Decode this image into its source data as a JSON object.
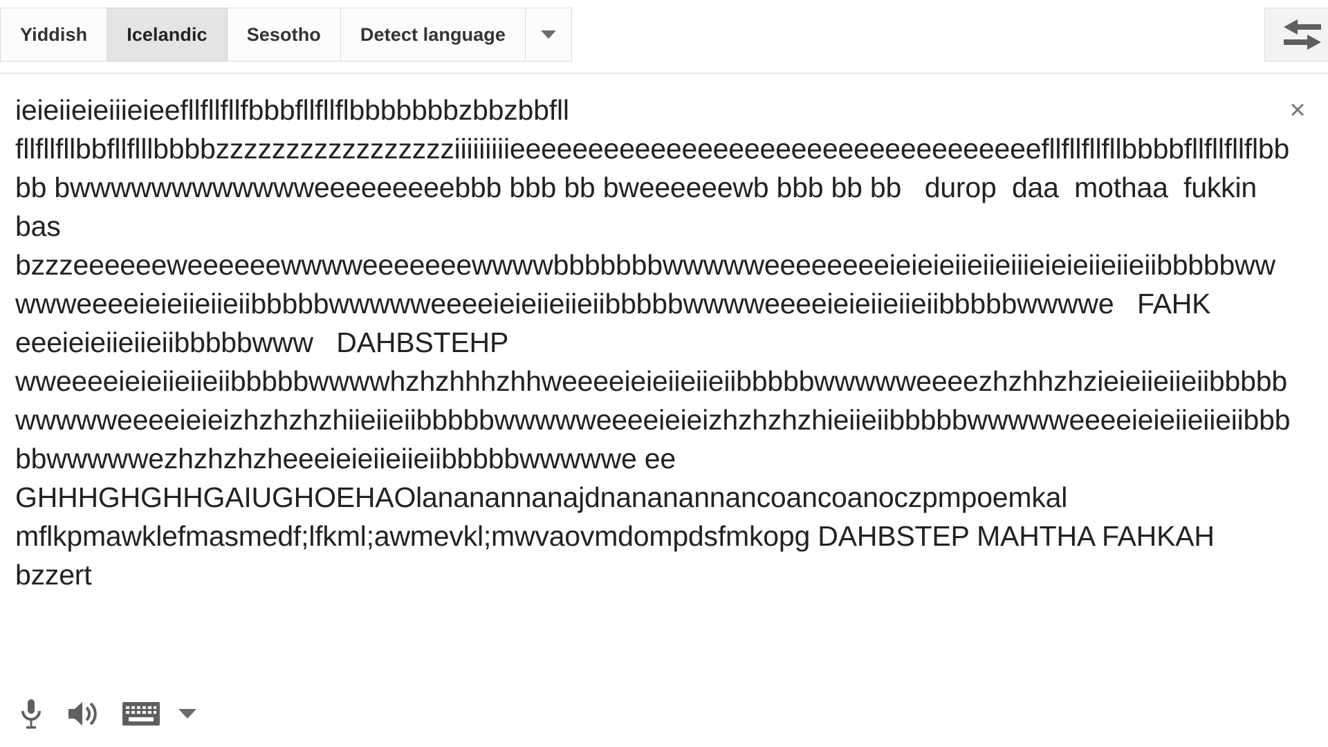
{
  "language_bar": {
    "tabs": [
      {
        "label": "Yiddish",
        "active": false
      },
      {
        "label": "Icelandic",
        "active": true
      },
      {
        "label": "Sesotho",
        "active": false
      },
      {
        "label": "Detect language",
        "active": false
      }
    ],
    "more_languages_icon": "chevron-down-icon",
    "swap_languages_icon": "swap-horizontal-arrows-icon"
  },
  "source_panel": {
    "text": "ieieiieieiiieieefllfllfllfbbbfllfllflbbbbbbbzbbzbbfll fllfllfllbbfllflllbbbbzzzzzzzzzzzzzzzzziiiiiiiiieeeeeeeeeeeeeeeeeeeeeeeeeeeeeeeeeefllfllfllfllbbbbfllfllfllflbbbb bwwwwwwwwwwwweeeeeeeeebbb bbb bb bweeeeeewb bbb bb bb   durop  daa  mothaa  fukkin  bas bzzzeeeeeeweeeeeewwwweeeeeeewwwwbbbbbbbwwwwweeeeeeeeieieieiieiieiiieieieiieiieiibbbbbwwwwweeeeieieiieiieiibbbbbwwwwweeeeieieiieiieiibbbbbwwwweeeeieieiieiieiibbbbbwwwwe   FAHK   eeeieieiieiieiibbbbbwww   DAHBSTEHP wweeeeieieiieiieiibbbbbwwwwhzhzhhhzhhweeeeieieiieiieiibbbbbwwwwweeeezhzhhzhzieieiieiieiibbbbbwwwwweeeeieieizhzhzhzhiieiieiibbbbbwwwwweeeeieieizhzhzhzhieiieiibbbbbwwwwweeeeieieiieiieiibbbbbwwwwwezhzhzhzheeeieieiieiieiibbbbbwwwwwe ee GHHHGHGHHGAIUGHOEHAOlananannanajdnananannancoancoanoczpmpoemkal mflkpmawklefmasmedf;lfkml;awmevkl;mwvaovmdompdsfmkopg DAHBSTEP MAHTHA FAHKAH bzzert",
    "clear_icon": "close-x-icon",
    "clear_label": "×"
  },
  "bottom_toolbar": {
    "items": [
      {
        "icon": "microphone-icon",
        "name": "voice-input-button"
      },
      {
        "icon": "speaker-icon",
        "name": "listen-button"
      },
      {
        "icon": "keyboard-icon",
        "name": "keyboard-button"
      },
      {
        "icon": "chevron-down-icon",
        "name": "keyboard-options-caret"
      }
    ]
  },
  "colors": {
    "text": "#222222",
    "icon_gray": "#6b6b6b",
    "tab_active_bg": "#e4e4e4",
    "tab_bg": "#fcfcfc",
    "border": "#dcdcdc"
  }
}
